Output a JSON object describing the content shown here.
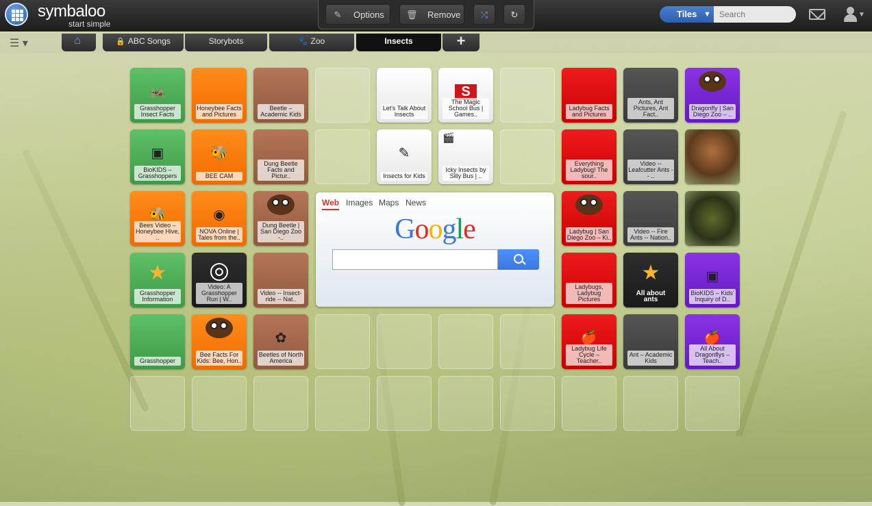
{
  "header": {
    "logo_text": "symbaloo",
    "logo_sub": "start simple",
    "options_label": "Options",
    "remove_label": "Remove",
    "view_toggle": "Tiles",
    "search_placeholder": "Search"
  },
  "tabs": [
    {
      "label": "",
      "icon": "home-icon"
    },
    {
      "label": "ABC Songs",
      "icon": "lock-icon"
    },
    {
      "label": "Storybots",
      "icon": ""
    },
    {
      "label": "Zoo",
      "icon": "paw-icon"
    },
    {
      "label": "Insects",
      "icon": "",
      "active": true
    },
    {
      "label": "+",
      "icon": "plus-icon"
    }
  ],
  "tiles": [
    {
      "color": "green",
      "label": "Grasshopper Insect Facts",
      "icon": "grasshopper-icon"
    },
    {
      "color": "orange",
      "label": "Honeybee Facts and Pictures"
    },
    {
      "color": "brown",
      "label": "Beetle – Academic Kids"
    },
    {
      "color": "empty",
      "label": ""
    },
    {
      "color": "white",
      "label": "Let's Talk About Insects"
    },
    {
      "color": "white",
      "label": "The Magic School Bus | Games..",
      "icon": "scholastic-logo"
    },
    {
      "color": "empty",
      "label": ""
    },
    {
      "color": "red",
      "label": "Ladybug Facts and Pictures"
    },
    {
      "color": "gray",
      "label": "Ants, Ant Pictures, Ant Fact.."
    },
    {
      "color": "purple",
      "label": "Dragonfly | San Diego Zoo – ..",
      "icon": "monkey-icon"
    },
    {
      "color": "green",
      "label": "BioKIDS – Grasshoppers",
      "icon": "biokids-icon"
    },
    {
      "color": "orange",
      "label": "BEE CAM",
      "icon": "bees-icon"
    },
    {
      "color": "brown",
      "label": "Dung Beetle Facts and Pictur.."
    },
    {
      "color": "empty",
      "label": ""
    },
    {
      "color": "white",
      "label": "Insects for Kids",
      "icon": "crayons-icon"
    },
    {
      "color": "white",
      "label": "Icky Insects by Silly Bus | ..",
      "icon": "video-icon"
    },
    {
      "color": "empty",
      "label": ""
    },
    {
      "color": "red",
      "label": "Everything Ladybug! The sour.."
    },
    {
      "color": "gray",
      "label": "Video -- Leafcutter Ants -- .."
    },
    {
      "color": "photo1",
      "label": "",
      "icon": "dragonfly-photo"
    },
    {
      "color": "orange",
      "label": "Bees Video – Honeybee Hive, ..",
      "icon": "bee-icon"
    },
    {
      "color": "orange",
      "label": "NOVA Online | Tales from the..",
      "icon": "pbs-icon"
    },
    {
      "color": "brown",
      "label": "Dung Beetle | San Diego Zoo -..",
      "icon": "monkey-icon"
    },
    {
      "color": "google",
      "label": ""
    },
    {
      "color": "google",
      "label": ""
    },
    {
      "color": "google",
      "label": ""
    },
    {
      "color": "google",
      "label": ""
    },
    {
      "color": "red",
      "label": "Ladybug | San Diego Zoo – Ki..",
      "icon": "monkey-icon"
    },
    {
      "color": "gray",
      "label": "Video -- Fire Ants -- Nation.."
    },
    {
      "color": "photo2",
      "label": "",
      "icon": "insect-photo"
    },
    {
      "color": "green",
      "label": "Grasshopper Information",
      "icon": "star-icon"
    },
    {
      "color": "dark",
      "label": "Video: A Grasshopper Run | W..",
      "icon": "play-icon"
    },
    {
      "color": "brown",
      "label": "Video -- Insect-ride -- Nat.."
    },
    {
      "color": "google",
      "label": ""
    },
    {
      "color": "google",
      "label": ""
    },
    {
      "color": "google",
      "label": ""
    },
    {
      "color": "google",
      "label": ""
    },
    {
      "color": "red",
      "label": "Ladybugs, Ladybug Pictures"
    },
    {
      "color": "dark",
      "label": "All about ants",
      "icon": "star-icon",
      "dark": true
    },
    {
      "color": "purple",
      "label": "BioKIDS – Kids' Inquiry of D..",
      "icon": "biokids-icon"
    },
    {
      "color": "green",
      "label": "Grasshopper"
    },
    {
      "color": "orange",
      "label": "Bee Facts For Kids: Bee, Hon..",
      "icon": "monkey-icon"
    },
    {
      "color": "brown",
      "label": "Beetles of North America",
      "icon": "flower-icon"
    },
    {
      "color": "empty",
      "label": ""
    },
    {
      "color": "empty",
      "label": ""
    },
    {
      "color": "empty",
      "label": ""
    },
    {
      "color": "empty",
      "label": ""
    },
    {
      "color": "red",
      "label": "Ladybug Life Cycle – Teacher..",
      "icon": "apple-icon"
    },
    {
      "color": "gray",
      "label": "Ant – Academic Kids"
    },
    {
      "color": "purple",
      "label": "All About Dragonflys – Teach..",
      "icon": "apple-icon"
    },
    {
      "color": "empty",
      "label": ""
    },
    {
      "color": "empty",
      "label": ""
    },
    {
      "color": "empty",
      "label": ""
    },
    {
      "color": "empty",
      "label": ""
    },
    {
      "color": "empty",
      "label": ""
    },
    {
      "color": "empty",
      "label": ""
    },
    {
      "color": "empty",
      "label": ""
    },
    {
      "color": "empty",
      "label": ""
    },
    {
      "color": "empty",
      "label": ""
    },
    {
      "color": "empty",
      "label": ""
    }
  ],
  "google": {
    "tabs": [
      "Web",
      "Images",
      "Maps",
      "News"
    ],
    "logo": "Google"
  }
}
